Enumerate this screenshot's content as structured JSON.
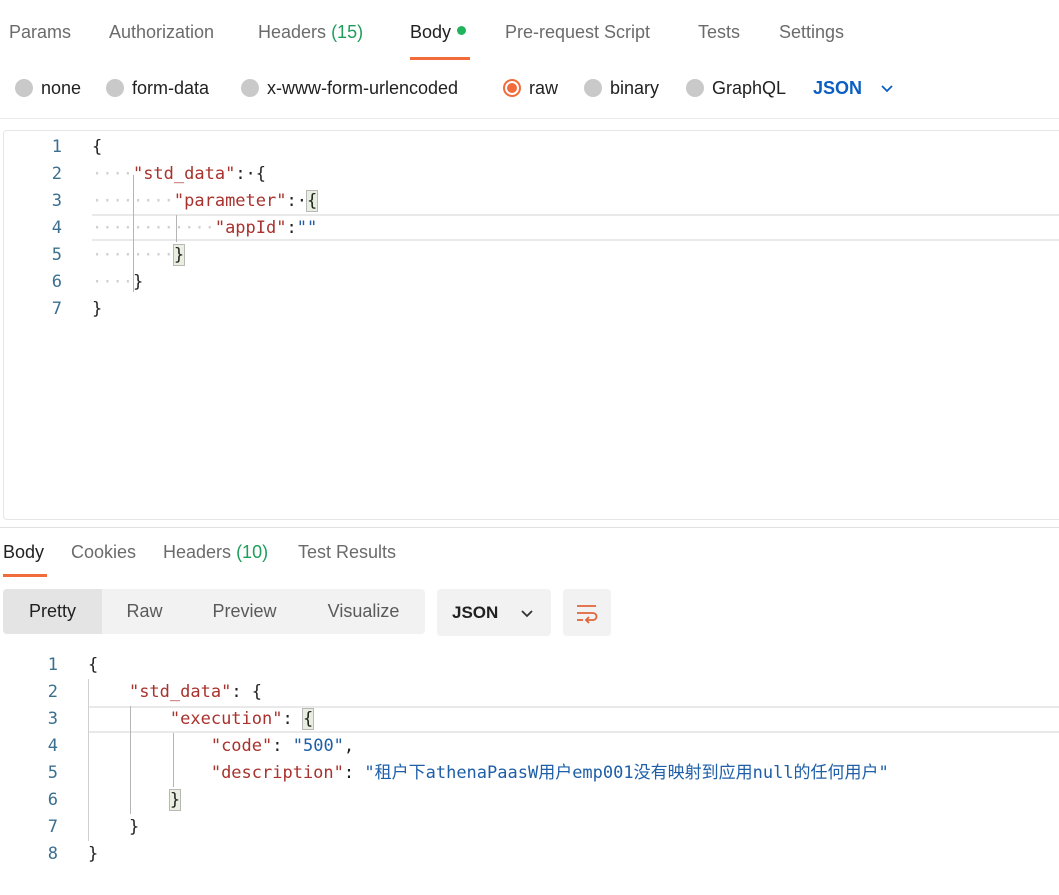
{
  "request_tabs": [
    {
      "label": "Params",
      "count": ""
    },
    {
      "label": "Authorization",
      "count": ""
    },
    {
      "label": "Headers",
      "count": "(15)"
    },
    {
      "label": "Body",
      "count": ""
    },
    {
      "label": "Pre-request Script",
      "count": ""
    },
    {
      "label": "Tests",
      "count": ""
    },
    {
      "label": "Settings",
      "count": ""
    }
  ],
  "active_request_tab": "Body",
  "body_types": [
    {
      "label": "none",
      "selected": false
    },
    {
      "label": "form-data",
      "selected": false
    },
    {
      "label": "x-www-form-urlencoded",
      "selected": false
    },
    {
      "label": "raw",
      "selected": true
    },
    {
      "label": "binary",
      "selected": false
    },
    {
      "label": "GraphQL",
      "selected": false
    }
  ],
  "request_language": "JSON",
  "request_body": {
    "line_numbers": [
      "1",
      "2",
      "3",
      "4",
      "5",
      "6",
      "7"
    ],
    "lines": [
      {
        "indent": "",
        "key": "",
        "colon": "",
        "value": "",
        "punct": "{"
      },
      {
        "indent": "····",
        "key": "\"std_data\"",
        "colon": ":·",
        "value": "",
        "punct": "{"
      },
      {
        "indent": "········",
        "key": "\"parameter\"",
        "colon": ":·",
        "value": "",
        "punct": "{"
      },
      {
        "indent": "············",
        "key": "\"appId\"",
        "colon": ":",
        "value": "\"\"",
        "punct": ""
      },
      {
        "indent": "········",
        "key": "",
        "colon": "",
        "value": "",
        "punct": "}"
      },
      {
        "indent": "····",
        "key": "",
        "colon": "",
        "value": "",
        "punct": "}"
      },
      {
        "indent": "",
        "key": "",
        "colon": "",
        "value": "",
        "punct": "}"
      }
    ]
  },
  "response_tabs": [
    {
      "label": "Body",
      "count": ""
    },
    {
      "label": "Cookies",
      "count": ""
    },
    {
      "label": "Headers",
      "count": "(10)"
    },
    {
      "label": "Test Results",
      "count": ""
    }
  ],
  "active_response_tab": "Body",
  "view_modes": [
    "Pretty",
    "Raw",
    "Preview",
    "Visualize"
  ],
  "active_view_mode": "Pretty",
  "response_language": "JSON",
  "response_body": {
    "line_numbers": [
      "1",
      "2",
      "3",
      "4",
      "5",
      "6",
      "7",
      "8"
    ],
    "lines": [
      {
        "indent": "",
        "key": "",
        "colon": "",
        "value": "",
        "punct": "{"
      },
      {
        "indent": "    ",
        "key": "\"std_data\"",
        "colon": ": ",
        "value": "",
        "punct": "{"
      },
      {
        "indent": "        ",
        "key": "\"execution\"",
        "colon": ": ",
        "value": "",
        "punct": "{"
      },
      {
        "indent": "            ",
        "key": "\"code\"",
        "colon": ": ",
        "value": "\"500\"",
        "punct": ","
      },
      {
        "indent": "            ",
        "key": "\"description\"",
        "colon": ": ",
        "value": "\"租户下athenaPaasW用户emp001没有映射到应用null的任何用户\"",
        "punct": ""
      },
      {
        "indent": "        ",
        "key": "",
        "colon": "",
        "value": "",
        "punct": "}"
      },
      {
        "indent": "    ",
        "key": "",
        "colon": "",
        "value": "",
        "punct": "}"
      },
      {
        "indent": "",
        "key": "",
        "colon": "",
        "value": "",
        "punct": "}"
      }
    ]
  },
  "colors": {
    "accent": "#f26b3a",
    "key": "#a8322d",
    "string": "#1e5fa8",
    "link": "#0b5fc2",
    "count": "#1e9e5a"
  }
}
